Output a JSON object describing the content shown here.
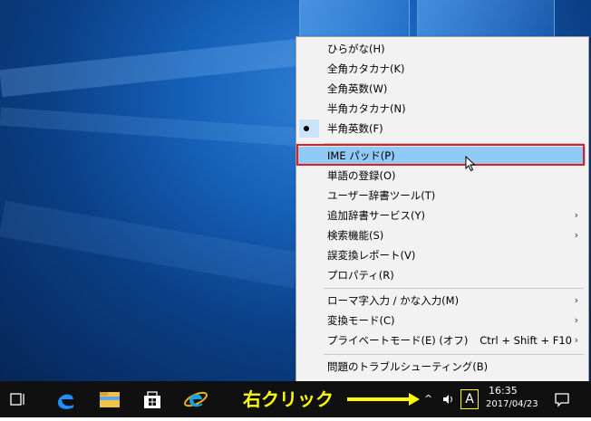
{
  "menu": {
    "items": [
      {
        "label": "ひらがな(H)"
      },
      {
        "label": "全角カタカナ(K)"
      },
      {
        "label": "全角英数(W)"
      },
      {
        "label": "半角カタカナ(N)"
      },
      {
        "label": "半角英数(F)",
        "checked": true
      },
      {
        "label": "IME パッド(P)",
        "highlighted": true
      },
      {
        "label": "単語の登録(O)"
      },
      {
        "label": "ユーザー辞書ツール(T)"
      },
      {
        "label": "追加辞書サービス(Y)",
        "submenu": true
      },
      {
        "label": "検索機能(S)",
        "submenu": true
      },
      {
        "label": "誤変換レポート(V)"
      },
      {
        "label": "プロパティ(R)"
      },
      {
        "label": "ローマ字入力 / かな入力(M)",
        "submenu": true
      },
      {
        "label": "変換モード(C)",
        "submenu": true
      },
      {
        "label": "プライベートモード(E) (オフ)",
        "shortcut": "Ctrl + Shift + F10",
        "submenu": true
      },
      {
        "label": "問題のトラブルシューティング(B)"
      }
    ],
    "submenu_arrow": "›",
    "highlight_color": "#91c9f7",
    "annotation_box_color": "#e11b22"
  },
  "taskbar": {
    "icons": [
      "task-view-icon",
      "edge-icon",
      "file-explorer-icon",
      "store-icon",
      "ie-icon"
    ],
    "annotation": "右クリック",
    "annotation_color": "#ffff00",
    "ime_indicator": "A",
    "tray_chevron": "^",
    "clock_time": "16:35",
    "clock_date": "2017/04/23"
  }
}
